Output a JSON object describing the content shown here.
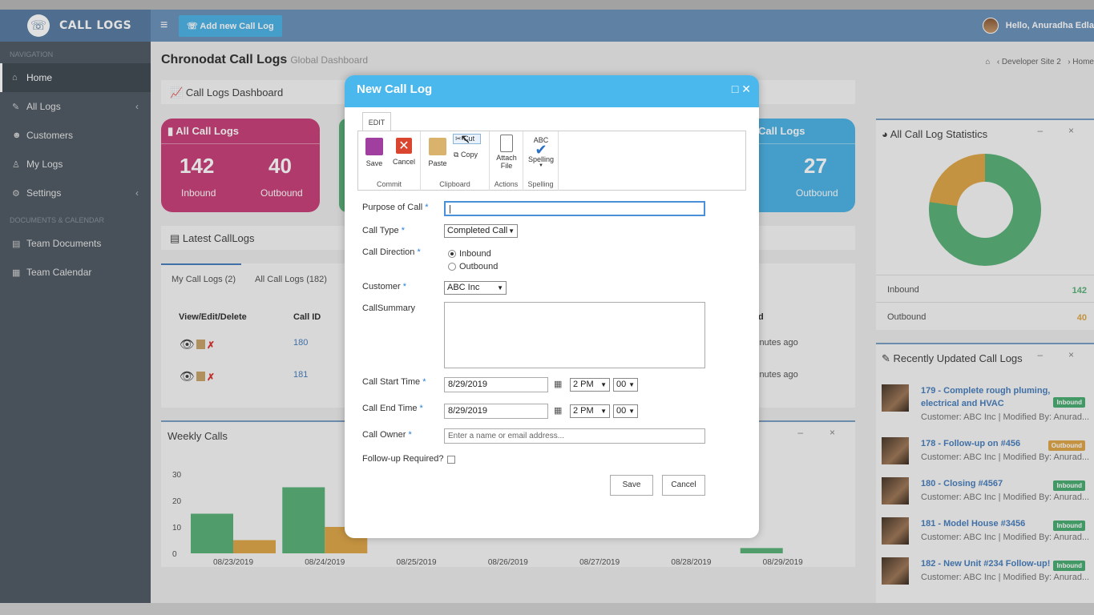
{
  "header": {
    "brand": "CALL LOGS",
    "add_button": "Add new Call Log",
    "user_greeting": "Hello, Anuradha Edla"
  },
  "sidebar": {
    "section1": "NAVIGATION",
    "items": [
      {
        "label": "Home",
        "icon": "home-icon"
      },
      {
        "label": "All Logs",
        "icon": "edit-icon"
      },
      {
        "label": "Customers",
        "icon": "users-icon"
      },
      {
        "label": "My Logs",
        "icon": "user-icon"
      },
      {
        "label": "Settings",
        "icon": "gears-icon"
      }
    ],
    "section2": "DOCUMENTS & CALENDAR",
    "items2": [
      {
        "label": "Team Documents",
        "icon": "book-icon"
      },
      {
        "label": "Team Calendar",
        "icon": "calendar-icon"
      }
    ]
  },
  "page": {
    "title": "Chronodat Call Logs",
    "subtitle": "Global Dashboard",
    "breadcrumb_1": "‹ Developer Site 2",
    "breadcrumb_2": "›   Home"
  },
  "dashboard": {
    "panel_title": "Call Logs Dashboard",
    "all_card": {
      "title": "All Call Logs",
      "inbound": "142",
      "inbound_label": "Inbound",
      "outbound": "40",
      "outbound_label": "Outbound"
    },
    "right_card": {
      "title": "Call Logs",
      "outbound": "27",
      "outbound_label": "Outbound"
    }
  },
  "latest": {
    "title": "Latest CallLogs",
    "tab1": "My Call Logs (2)",
    "tab2": "All Call Logs (182)",
    "col_actions": "View/Edit/Delete",
    "col_id": "Call ID",
    "col_modified": "d",
    "rows": [
      {
        "id": "180",
        "modified": "inutes ago"
      },
      {
        "id": "181",
        "modified": "inutes ago"
      }
    ]
  },
  "weekly": {
    "title": "Weekly Calls"
  },
  "chart_data": {
    "type": "bar",
    "title": "Weekly Calls",
    "categories": [
      "08/23/2019",
      "08/24/2019",
      "08/25/2019",
      "08/26/2019",
      "08/27/2019",
      "08/28/2019",
      "08/29/2019"
    ],
    "series": [
      {
        "name": "Inbound",
        "color": "#5cb27a",
        "values": [
          15,
          25,
          0,
          0,
          0,
          0,
          2
        ]
      },
      {
        "name": "Outbound",
        "color": "#e0a84a",
        "values": [
          5,
          10,
          0,
          0,
          0,
          0,
          0
        ]
      }
    ],
    "yticks": [
      "0",
      "10",
      "20",
      "30"
    ],
    "ylim": [
      0,
      30
    ]
  },
  "statistics": {
    "title": "All Call Log Statistics",
    "inbound_label": "Inbound",
    "inbound_value": "142",
    "outbound_label": "Outbound",
    "outbound_value": "40",
    "colors": {
      "inbound": "#5cb27a",
      "outbound": "#e0a84a"
    }
  },
  "recent": {
    "title": "Recently Updated Call Logs",
    "items": [
      {
        "title": "179 - Complete rough pluming, electrical and HVAC",
        "sub": "Customer: ABC Inc | Modified By: Anurad...",
        "badge": "Inbound"
      },
      {
        "title": "178 - Follow-up on #456",
        "sub": "Customer: ABC Inc | Modified By: Anurad...",
        "badge": "Outbound"
      },
      {
        "title": "180 - Closing #4567",
        "sub": "Customer: ABC Inc | Modified By: Anurad...",
        "badge": "Inbound"
      },
      {
        "title": "181 - Model House #3456",
        "sub": "Customer: ABC Inc | Modified By: Anurad...",
        "badge": "Inbound"
      },
      {
        "title": "182 - New Unit #234 Follow-up!",
        "sub": "Customer: ABC Inc | Modified By: Anurad...",
        "badge": "Inbound"
      }
    ]
  },
  "modal": {
    "title": "New Call Log",
    "ribbon_tab": "EDIT",
    "ribbon": {
      "save": "Save",
      "cancel": "Cancel",
      "commit": "Commit",
      "paste": "Paste",
      "cut": "Cut",
      "copy": "Copy",
      "clipboard": "Clipboard",
      "attach_1": "Attach",
      "attach_2": "File",
      "actions": "Actions",
      "abc": "ABC",
      "spelling_btn": "Spelling",
      "spelling": "Spelling"
    },
    "fields": {
      "purpose": "Purpose of Call",
      "call_type": "Call Type",
      "call_type_value": "Completed Call",
      "direction": "Call Direction",
      "direction_in": "Inbound",
      "direction_out": "Outbound",
      "customer": "Customer",
      "customer_value": "ABC Inc",
      "summary": "CallSummary",
      "start": "Call Start Time",
      "start_date": "8/29/2019",
      "start_hour": "2 PM",
      "start_min": "00",
      "end": "Call End Time",
      "end_date": "8/29/2019",
      "end_hour": "2 PM",
      "end_min": "00",
      "owner": "Call Owner",
      "owner_placeholder": "Enter a name or email address...",
      "followup": "Follow-up Required?"
    },
    "save_button": "Save",
    "cancel_button": "Cancel"
  }
}
